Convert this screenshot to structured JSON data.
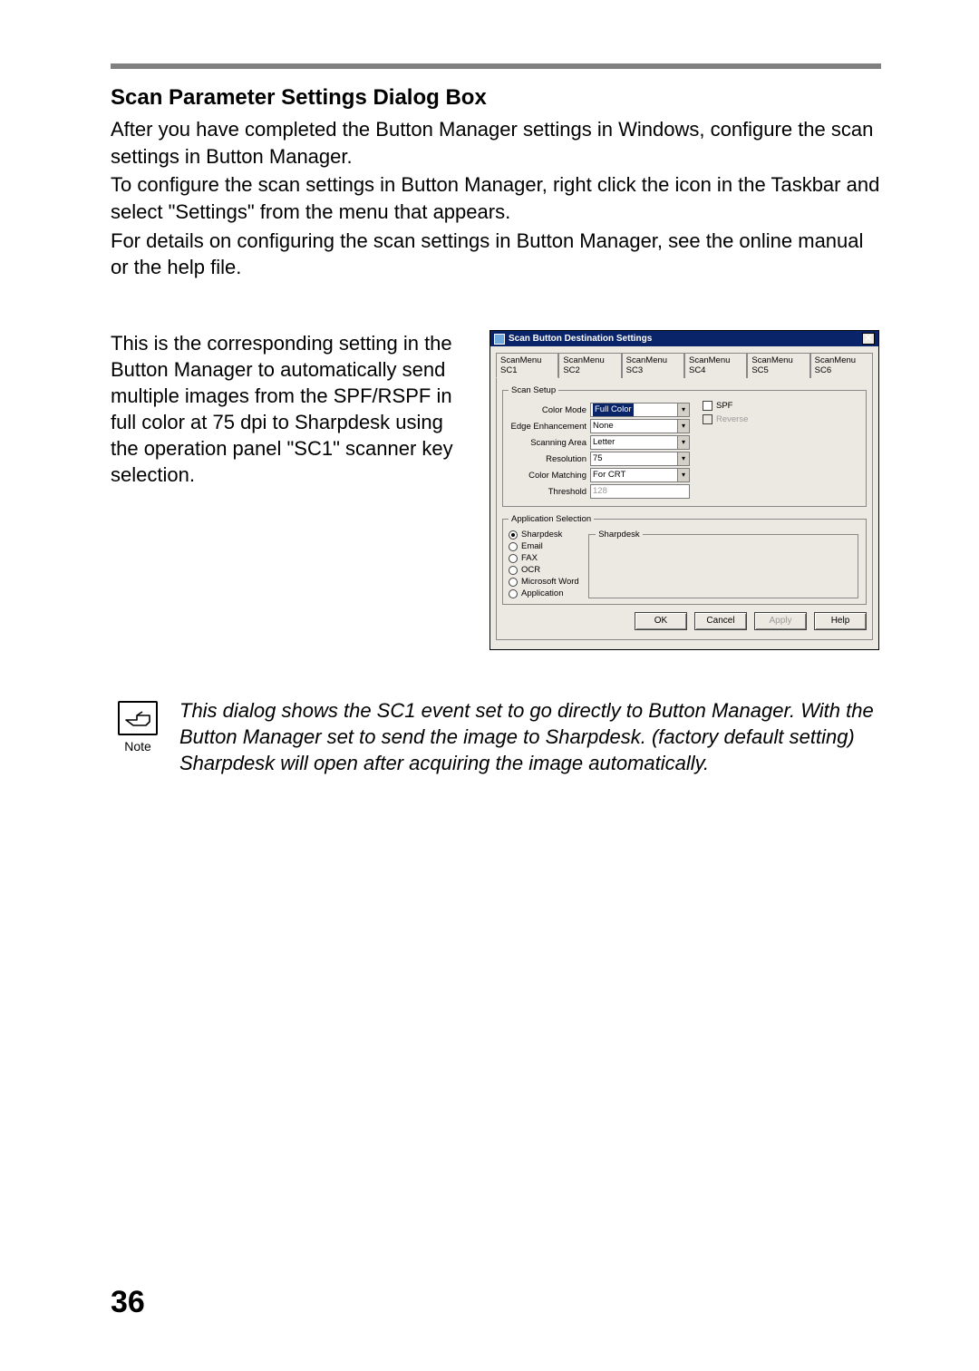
{
  "heading": "Scan Parameter Settings Dialog Box",
  "para1a": "After you have completed the Button Manager settings in Windows, configure the scan settings in Button Manager.",
  "para1b": "To configure the scan settings in Button Manager, right click the icon in the Taskbar and select \"Settings\" from the menu that appears.",
  "para1c": "For details on configuring the scan settings in Button Manager, see the online manual or the help file.",
  "left_para": "This is the corresponding setting in the Button Manager to automatically send multiple images from the SPF/RSPF in full color at 75 dpi to Sharpdesk using the operation panel \"SC1\" scanner key selection.",
  "note_label": "Note",
  "note_text": "This dialog shows the SC1 event set to go directly to Button Manager. With the Button Manager set to send the image to Sharpdesk. (factory default setting) Sharpdesk will open after acquiring the image automatically.",
  "page_number": "36",
  "dialog": {
    "title": "Scan Button Destination Settings",
    "close_glyph": "✕",
    "tabs": [
      "ScanMenu SC1",
      "ScanMenu SC2",
      "ScanMenu SC3",
      "ScanMenu SC4",
      "ScanMenu SC5",
      "ScanMenu SC6"
    ],
    "active_tab_index": 0,
    "scan_setup": {
      "legend": "Scan Setup",
      "color_mode_label": "Color Mode",
      "color_mode_value": "Full Color",
      "edge_label": "Edge Enhancement",
      "edge_value": "None",
      "area_label": "Scanning Area",
      "area_value": "Letter",
      "res_label": "Resolution",
      "res_value": "75",
      "cm_label": "Color Matching",
      "cm_value": "For CRT",
      "thresh_label": "Threshold",
      "thresh_value": "128",
      "chk_spf": "SPF",
      "chk_reverse": "Reverse"
    },
    "app_sel": {
      "legend": "Application Selection",
      "options": [
        "Sharpdesk",
        "Email",
        "FAX",
        "OCR",
        "Microsoft Word",
        "Application"
      ],
      "selected_index": 0,
      "inner_legend": "Sharpdesk"
    },
    "buttons": {
      "ok": "OK",
      "cancel": "Cancel",
      "apply": "Apply",
      "help": "Help"
    }
  }
}
